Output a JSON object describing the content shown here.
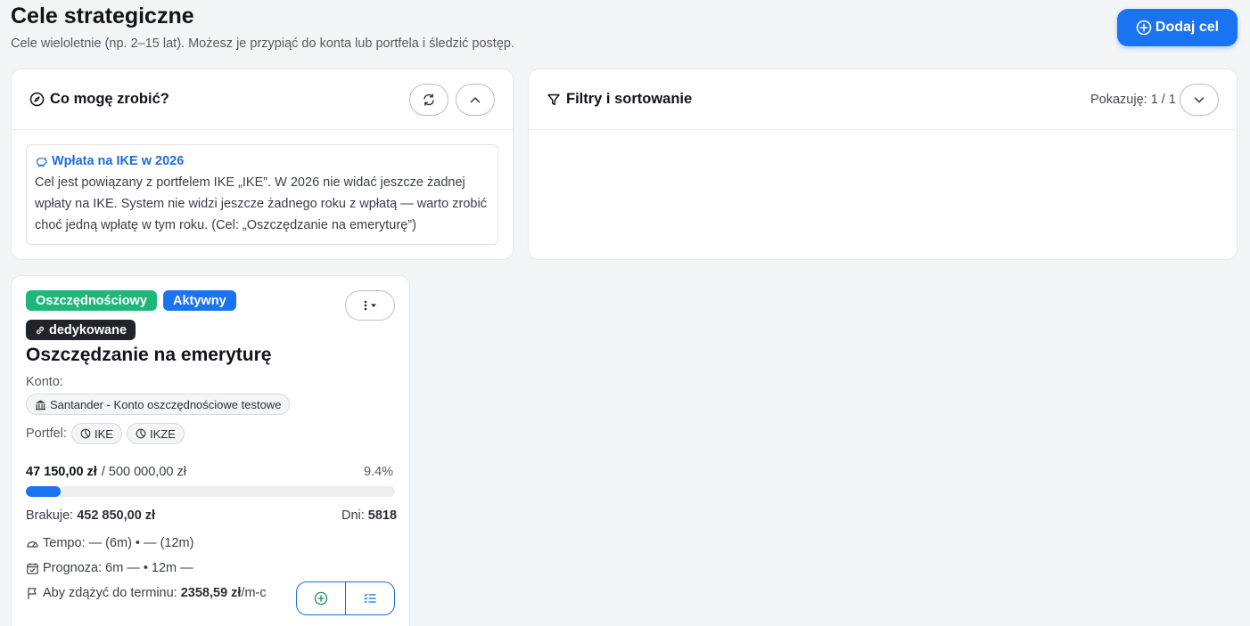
{
  "header": {
    "title": "Cele strategiczne",
    "subtitle": "Cele wieloletnie (np. 2–15 lat). Możesz je przypiąć do konta lub portfela i śledzić postęp.",
    "add_button_label": "Dodaj cel",
    "add_button_icon": "plus-circle-icon"
  },
  "tips_panel": {
    "title": "Co mogę zrobić?",
    "tip": {
      "title": "Wpłata na IKE w 2026",
      "text": "Cel jest powiązany z portfelem IKE „IKE”. W 2026 nie widać jeszcze żadnej wpłaty na IKE. System nie widzi jeszcze żadnego roku z wpłatą — warto zrobić choć jedną wpłatę w tym roku. (Cel: „Oszczędzanie na emeryturę”)"
    }
  },
  "filters_panel": {
    "title": "Filtry i sortowanie",
    "showing": "Pokazuję: 1 / 1"
  },
  "goal_card": {
    "badges": {
      "type": "Oszczędnościowy",
      "status": "Aktywny",
      "dedicated": "dedykowane"
    },
    "title": "Oszczędzanie na emeryturę",
    "account_label": "Konto:",
    "account_name": "Santander - Konto oszczędnościowe testowe",
    "portfolio_label": "Portfel:",
    "portfolios": [
      "IKE",
      "IKZE"
    ],
    "current_amount": "47 150,00 zł",
    "target_amount": "/ 500 000,00 zł",
    "percent": "9.4%",
    "progress": 0.094,
    "missing_label": "Brakuje:",
    "missing_value": "452 850,00 zł",
    "days_label": "Dni:",
    "days_value": "5818",
    "pace_text": "Tempo: — (6m) • — (12m)",
    "forecast_text": "Prognoza: 6m — • 12m —",
    "deadline_label": "Aby zdążyć do terminu:",
    "deadline_value": "2358,59 zł",
    "deadline_unit": "/m-c"
  },
  "colors": {
    "accent": "#1a73f0",
    "badge_type": "#1fb67a",
    "badge_status": "#1a73f0",
    "badge_dedicated": "#212529"
  }
}
